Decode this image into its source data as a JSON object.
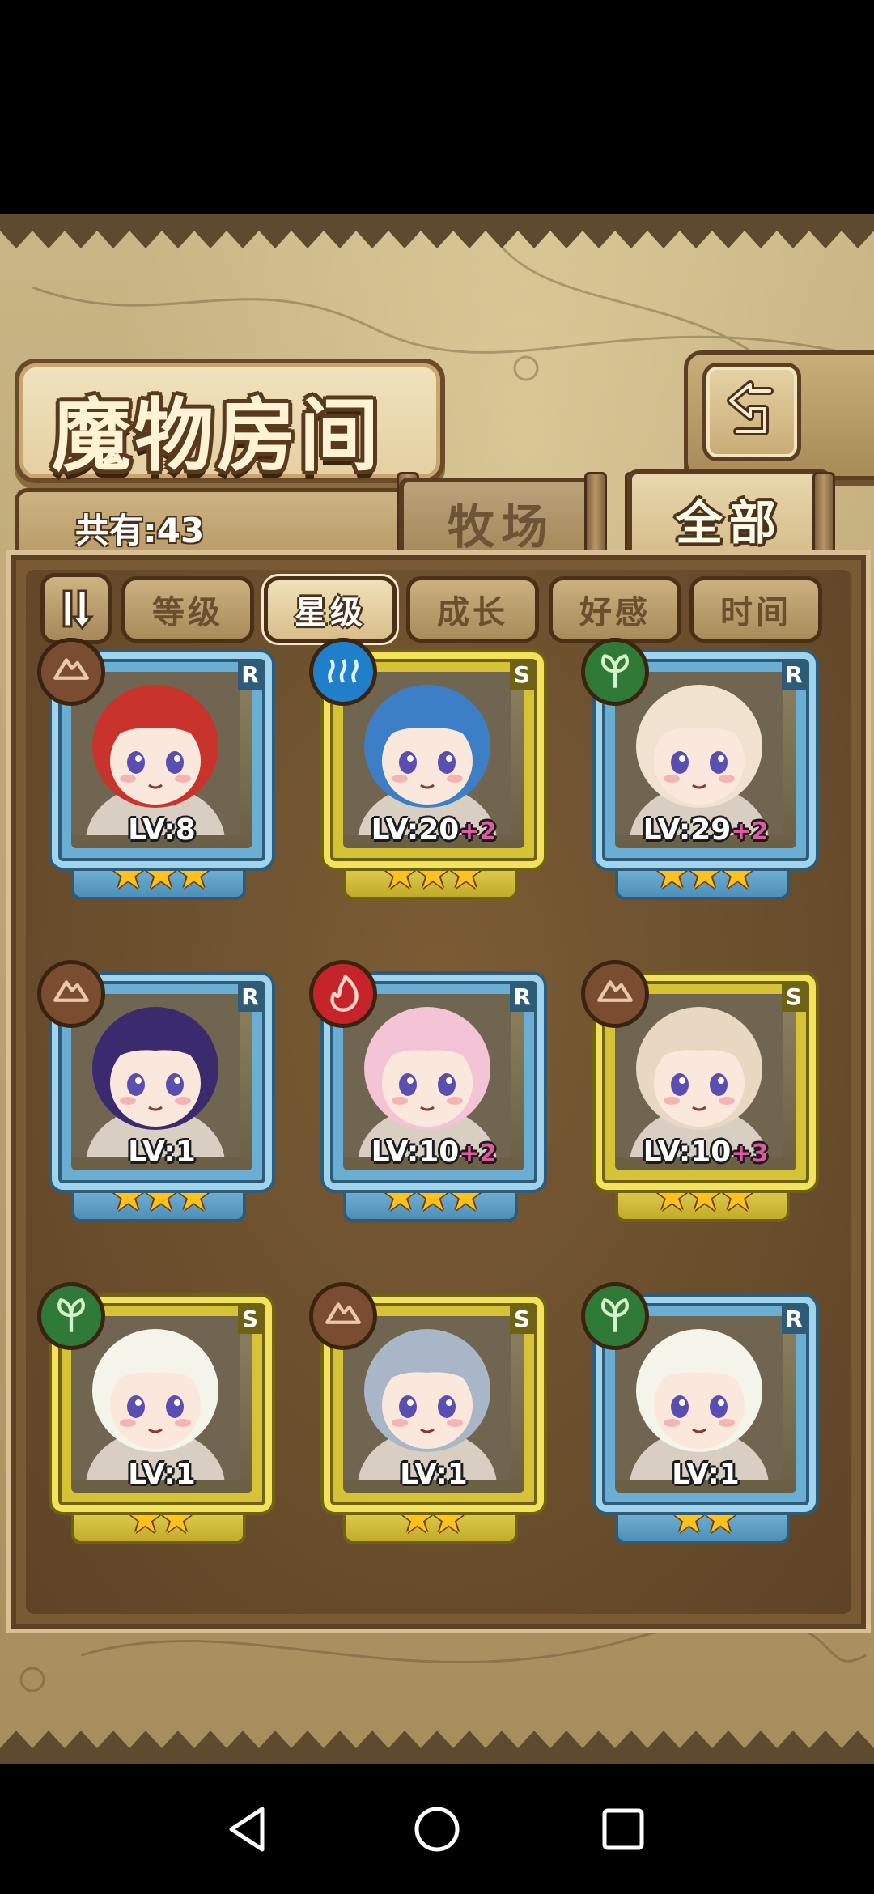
{
  "header": {
    "title": "魔物房间",
    "back_icon": "return-arrow-icon"
  },
  "collection": {
    "count_label": "共有:43"
  },
  "tabs": [
    {
      "label": "牧场",
      "active": false
    },
    {
      "label": "全部",
      "active": true
    }
  ],
  "sort_bar": {
    "toggle_icon": "sort-order-icon",
    "buttons": [
      {
        "label": "等级",
        "active": false
      },
      {
        "label": "星级",
        "active": true
      },
      {
        "label": "成长",
        "active": false
      },
      {
        "label": "好感",
        "active": false
      },
      {
        "label": "时间",
        "active": false
      }
    ]
  },
  "monsters": [
    {
      "rarity": "R",
      "element": "earth",
      "level": "LV:8",
      "bonus": "",
      "stars": 3,
      "frame": "blue",
      "hair": "#c8342c"
    },
    {
      "rarity": "S",
      "element": "water",
      "level": "LV:20",
      "bonus": "+2",
      "stars": 3,
      "frame": "gold",
      "hair": "#3d7fc7"
    },
    {
      "rarity": "R",
      "element": "wood",
      "level": "LV:29",
      "bonus": "+2",
      "stars": 3,
      "frame": "blue",
      "hair": "#f1e2cf"
    },
    {
      "rarity": "R",
      "element": "earth",
      "level": "LV:1",
      "bonus": "",
      "stars": 3,
      "frame": "blue",
      "hair": "#3b2b6e"
    },
    {
      "rarity": "R",
      "element": "fire",
      "level": "LV:10",
      "bonus": "+2",
      "stars": 3,
      "frame": "blue",
      "hair": "#f2c4d6"
    },
    {
      "rarity": "S",
      "element": "earth",
      "level": "LV:10",
      "bonus": "+3",
      "stars": 3,
      "frame": "gold",
      "hair": "#e8d8c2"
    },
    {
      "rarity": "S",
      "element": "wood",
      "level": "LV:1",
      "bonus": "",
      "stars": 2,
      "frame": "gold",
      "hair": "#f4f4ea"
    },
    {
      "rarity": "S",
      "element": "earth",
      "level": "LV:1",
      "bonus": "",
      "stars": 2,
      "frame": "gold",
      "hair": "#a9b6c8"
    },
    {
      "rarity": "R",
      "element": "wood",
      "level": "LV:1",
      "bonus": "",
      "stars": 2,
      "frame": "blue",
      "hair": "#f4f4ea"
    }
  ],
  "system_nav": {
    "back_icon": "triangle-back-icon",
    "home_icon": "circle-home-icon",
    "recents_icon": "square-recents-icon"
  },
  "colors": {
    "parchment": "#c9b585",
    "wood_border": "#5c3f22",
    "blue_frame": "#9fd4ec",
    "gold_frame": "#f3e35a",
    "star": "#ffc21c",
    "bonus": "#e05aa0"
  }
}
